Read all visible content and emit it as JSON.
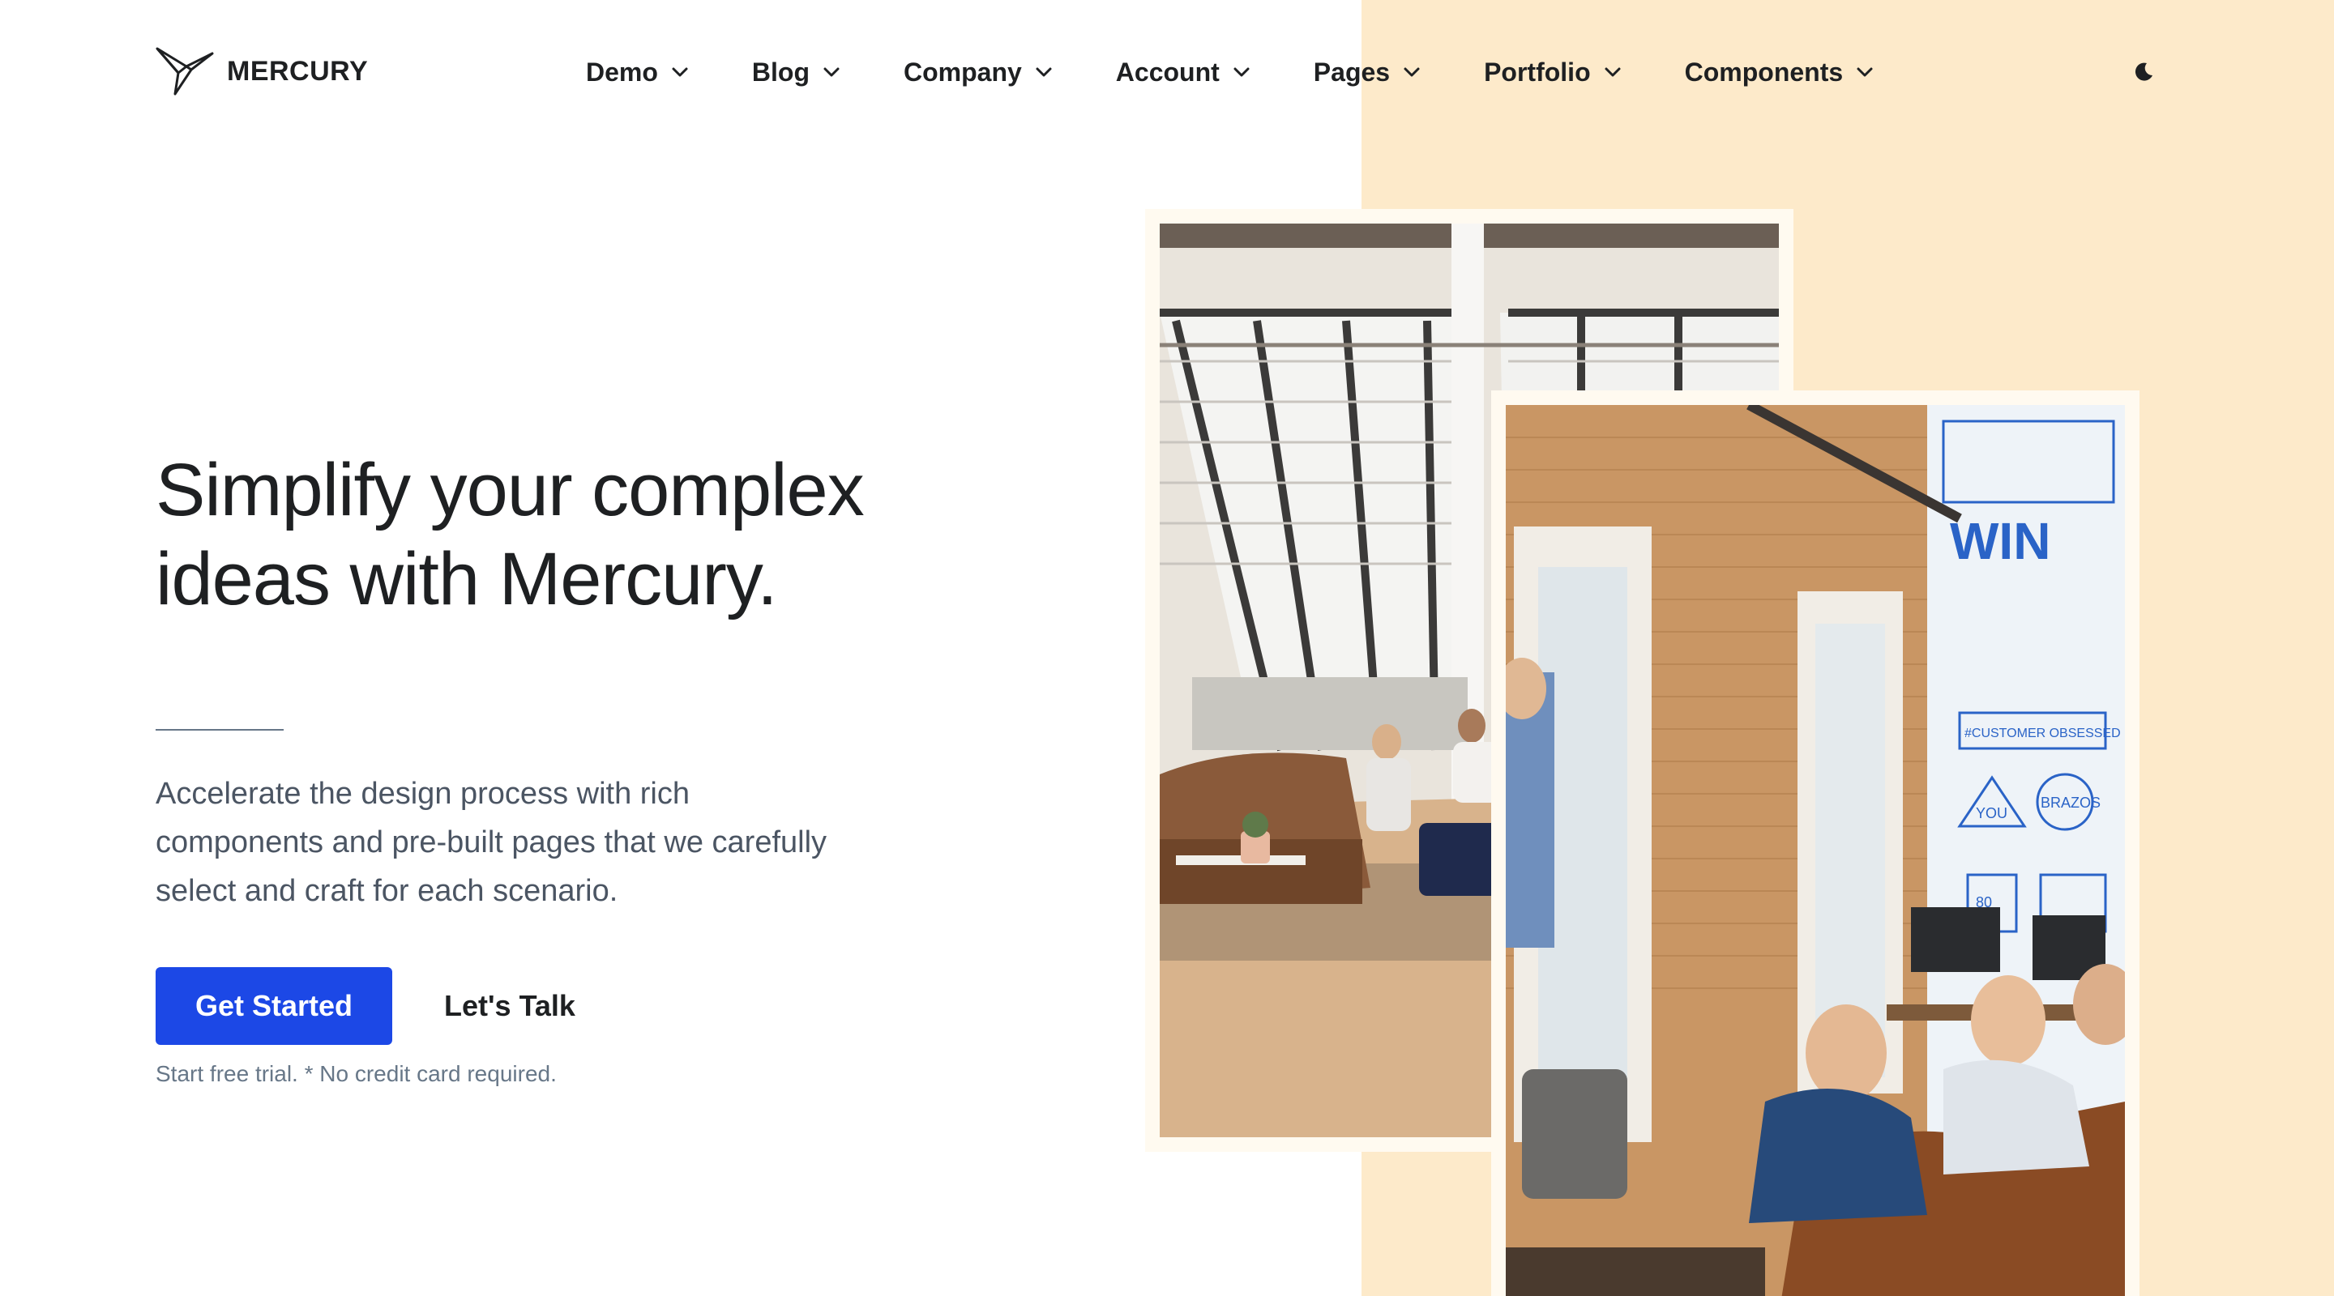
{
  "brand": {
    "name": "MERCURY",
    "logo_icon": "paper-bird-icon"
  },
  "nav": {
    "items": [
      {
        "label": "Demo"
      },
      {
        "label": "Blog"
      },
      {
        "label": "Company"
      },
      {
        "label": "Account"
      },
      {
        "label": "Pages"
      },
      {
        "label": "Portfolio"
      },
      {
        "label": "Components"
      }
    ],
    "dropdown_icon": "chevron-down-icon",
    "theme_toggle_icon": "moon-icon"
  },
  "hero": {
    "title_line1": "Simplify your complex",
    "title_line2": "ideas with Mercury.",
    "lead_line1": "Accelerate the design process with rich",
    "lead_line2": "components and pre-built pages that we carefully",
    "lead_line3": "select and craft for each scenario.",
    "primary_cta": "Get Started",
    "secondary_cta": "Let's Talk",
    "note": "Start free trial. * No credit card required."
  },
  "images": {
    "photo_1": "office lounge with large angled windows",
    "photo_2": "team meeting in brick-walled office",
    "wall_text_1": "WIN",
    "wall_text_2": "#CUSTOMER OBSESSED",
    "wall_text_3": "BRAZOS",
    "wall_text_4": "YOU",
    "wall_text_5": "80"
  },
  "colors": {
    "primary": "#1c48e6",
    "accent_panel": "#fdeaca",
    "text_dark": "#1e2022",
    "text_muted": "#677788"
  }
}
